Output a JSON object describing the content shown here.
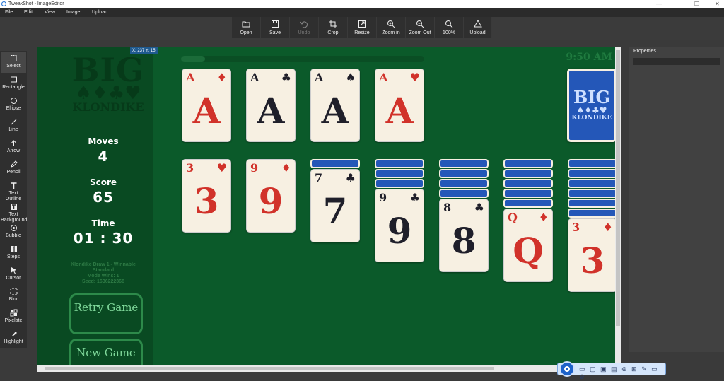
{
  "window": {
    "title": "TweakShot - ImageEditor",
    "controls": [
      "—",
      "❐",
      "✕"
    ]
  },
  "menu": [
    "File",
    "Edit",
    "View",
    "Image",
    "Upload"
  ],
  "toolbar": [
    {
      "label": "Open",
      "icon": "folder-icon",
      "disabled": false
    },
    {
      "label": "Save",
      "icon": "save-icon",
      "disabled": false
    },
    {
      "label": "Undo",
      "icon": "undo-icon",
      "disabled": true
    },
    {
      "label": "Crop",
      "icon": "crop-icon",
      "disabled": false
    },
    {
      "label": "Resize",
      "icon": "resize-icon",
      "disabled": false
    },
    {
      "label": "Zoom in",
      "icon": "zoom-in-icon",
      "disabled": false
    },
    {
      "label": "Zoom Out",
      "icon": "zoom-out-icon",
      "disabled": false
    },
    {
      "label": "100%",
      "icon": "zoom-icon",
      "disabled": false
    },
    {
      "label": "Upload",
      "icon": "upload-icon",
      "disabled": false
    }
  ],
  "tools": [
    {
      "label": "Select",
      "icon": "select-icon"
    },
    {
      "label": "Rectangle",
      "icon": "rectangle-icon"
    },
    {
      "label": "Ellipse",
      "icon": "ellipse-icon"
    },
    {
      "label": "Line",
      "icon": "line-icon"
    },
    {
      "label": "Arrow",
      "icon": "arrow-icon"
    },
    {
      "label": "Pencil",
      "icon": "pencil-icon"
    },
    {
      "label": "Text Outline",
      "icon": "text-outline-icon"
    },
    {
      "label": "Text Background",
      "icon": "text-background-icon"
    },
    {
      "label": "Bubble",
      "icon": "bubble-icon"
    },
    {
      "label": "Steps",
      "icon": "steps-icon"
    },
    {
      "label": "Cursor",
      "icon": "cursor-icon"
    },
    {
      "label": "Blur",
      "icon": "blur-icon"
    },
    {
      "label": "Pixelate",
      "icon": "pixelate-icon"
    },
    {
      "label": "Highlight",
      "icon": "highlight-icon"
    }
  ],
  "coord_readout": "X: 237 Y: 15",
  "properties": {
    "title": "Properties"
  },
  "game": {
    "logo": {
      "big": "BIG",
      "suits": "♠♦♣♥",
      "name": "KLONDIKE"
    },
    "moves_label": "Moves",
    "moves": "4",
    "score_label": "Score",
    "score": "65",
    "time_label": "Time",
    "time": "01 : 30",
    "info": [
      "Klondike Draw 1 - Winnable",
      "Standard",
      "Mode Wins: 1",
      "Seed: 1636222368"
    ],
    "retry": "Retry Game",
    "new_game": "New Game",
    "clock": "9:50 AM",
    "progress": 0.1,
    "foundations": [
      {
        "rank": "A",
        "suit": "♦",
        "color": "red"
      },
      {
        "rank": "A",
        "suit": "♣",
        "color": "black"
      },
      {
        "rank": "A",
        "suit": "♠",
        "color": "black"
      },
      {
        "rank": "A",
        "suit": "♥",
        "color": "red"
      }
    ],
    "stock": {
      "big": "BIG",
      "suits": "♠♦♣♥",
      "name": "KLONDIKE"
    },
    "tableau": [
      {
        "hidden": 0,
        "rank": "3",
        "suit": "♥",
        "color": "red"
      },
      {
        "hidden": 0,
        "rank": "9",
        "suit": "♦",
        "color": "red"
      },
      {
        "hidden": 1,
        "rank": "7",
        "suit": "♣",
        "color": "black"
      },
      {
        "hidden": 3,
        "rank": "9",
        "suit": "♣",
        "color": "black"
      },
      {
        "hidden": 4,
        "rank": "8",
        "suit": "♣",
        "color": "black"
      },
      {
        "hidden": 5,
        "rank": "Q",
        "suit": "♦",
        "color": "red"
      },
      {
        "hidden": 6,
        "rank": "3",
        "suit": "♦",
        "color": "red"
      }
    ]
  },
  "floating_toolbar": {
    "icons": "▭ ▢ ▣ ▤ ⊕ ⊞ ✎ ▭ ⚙"
  }
}
